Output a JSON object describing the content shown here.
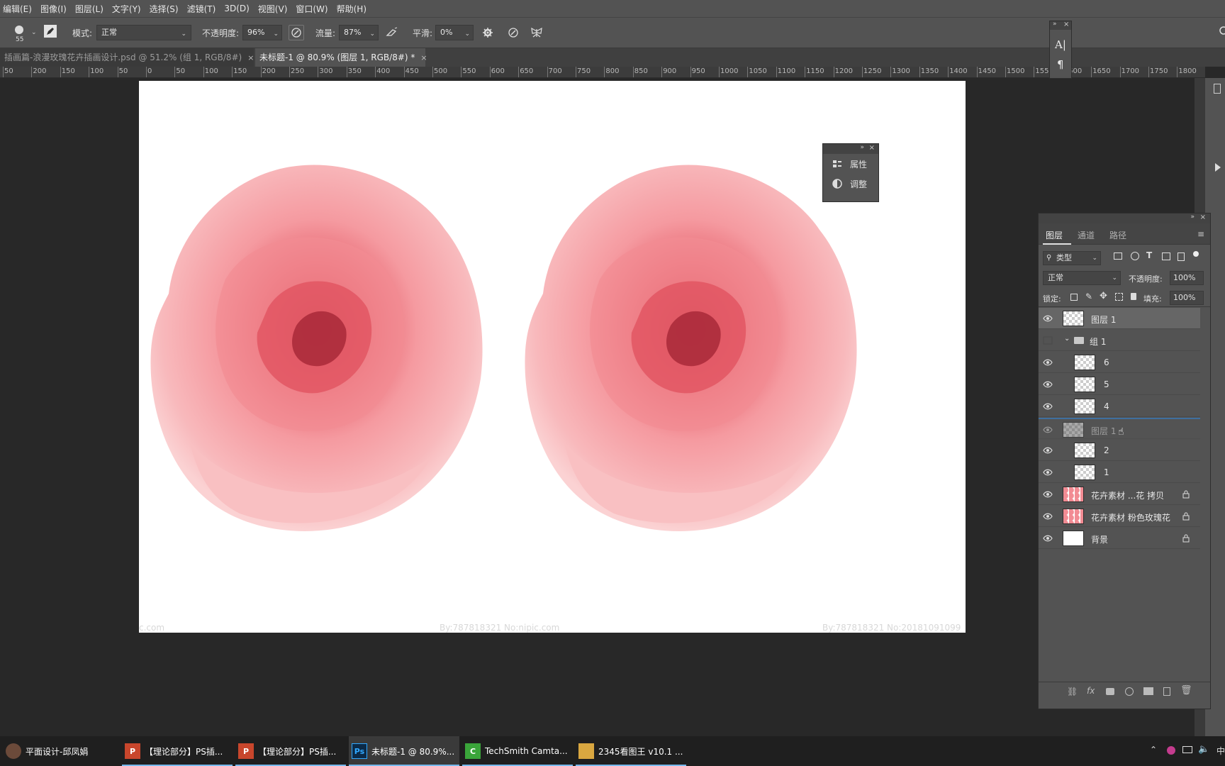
{
  "menu": [
    "编辑(E)",
    "图像(I)",
    "图层(L)",
    "文字(Y)",
    "选择(S)",
    "滤镜(T)",
    "3D(D)",
    "视图(V)",
    "窗口(W)",
    "帮助(H)"
  ],
  "options": {
    "brush_size": "55",
    "mode_label": "模式:",
    "mode_value": "正常",
    "opacity_label": "不透明度:",
    "opacity_value": "96%",
    "flow_label": "流量:",
    "flow_value": "87%",
    "smooth_label": "平滑:",
    "smooth_value": "0%"
  },
  "tabs": [
    {
      "label": "插画篇-浪漫玫瑰花卉插画设计.psd @ 51.2% (组 1, RGB/8#)",
      "close": "×",
      "active": false
    },
    {
      "label": "未标题-1 @ 80.9% (图层 1, RGB/8#) *",
      "close": "×",
      "active": true
    }
  ],
  "ruler": [
    "50",
    "200",
    "150",
    "100",
    "50",
    "0",
    "50",
    "100",
    "150",
    "200",
    "250",
    "300",
    "350",
    "400",
    "450",
    "500",
    "550",
    "600",
    "650",
    "700",
    "750",
    "800",
    "850",
    "900",
    "950",
    "1000",
    "1050",
    "1100",
    "1150",
    "1200",
    "1250",
    "1300",
    "1350",
    "1400",
    "1450",
    "1500",
    "1550",
    "1600",
    "1650",
    "1700",
    "1750",
    "1800"
  ],
  "canvas": {
    "watermark_left": "c.com",
    "watermark_mid": "By:787818321 No:nipic.com",
    "watermark_right": "By:787818321 No:20181091099"
  },
  "mini_panel": {
    "properties_label": "属性",
    "adjustments_label": "调整"
  },
  "layers_panel": {
    "tabs": [
      "图层",
      "通道",
      "路径"
    ],
    "filter_label": "类型",
    "blend_mode": "正常",
    "opacity_label": "不透明度:",
    "opacity_value": "100%",
    "lock_label": "锁定:",
    "fill_label": "填充:",
    "fill_value": "100%",
    "layers": [
      {
        "name": "图层 1",
        "visible": true,
        "selected": true,
        "type": "layer"
      },
      {
        "name": "组 1",
        "visible": false,
        "selected": false,
        "type": "group"
      },
      {
        "name": "6",
        "visible": true,
        "selected": false,
        "type": "layer"
      },
      {
        "name": "5",
        "visible": true,
        "selected": false,
        "type": "layer"
      },
      {
        "name": "4",
        "visible": true,
        "selected": false,
        "type": "layer"
      },
      {
        "name": "图层 1",
        "visible": true,
        "selected": false,
        "type": "drag-ghost"
      },
      {
        "name": "2",
        "visible": true,
        "selected": false,
        "type": "layer"
      },
      {
        "name": "1",
        "visible": true,
        "selected": false,
        "type": "layer"
      },
      {
        "name": "花卉素材 ...花 拷贝",
        "visible": true,
        "selected": false,
        "type": "smart",
        "locked": true
      },
      {
        "name": "花卉素材 粉色玫瑰花",
        "visible": true,
        "selected": false,
        "type": "smart",
        "locked": true
      },
      {
        "name": "背景",
        "visible": true,
        "selected": false,
        "type": "background",
        "locked": true
      }
    ]
  },
  "taskbar": [
    {
      "label": "平面设计-邱凤娟",
      "icon": "avatar"
    },
    {
      "label": "【理论部分】PS插...",
      "icon": "P"
    },
    {
      "label": "【理论部分】PS插...",
      "icon": "P"
    },
    {
      "label": "未标题-1 @ 80.9%...",
      "icon": "Ps"
    },
    {
      "label": "TechSmith Camta...",
      "icon": "C"
    },
    {
      "label": "2345看图王 v10.1 ...",
      "icon": "pic"
    }
  ],
  "tray_text": "中"
}
